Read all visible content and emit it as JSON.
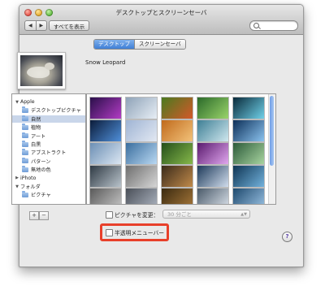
{
  "window": {
    "title": "デスクトップとスクリーンセーバ"
  },
  "toolbar": {
    "back": "◀",
    "forward": "▶",
    "show_all": "すべてを表示",
    "search_placeholder": ""
  },
  "tabs": [
    {
      "label": "デスクトップ",
      "active": true
    },
    {
      "label": "スクリーンセーバ",
      "active": false
    }
  ],
  "current_picture": {
    "name": "Snow Leopard"
  },
  "sources": [
    {
      "label": "Apple",
      "level": 0,
      "expander": "▼",
      "folder": false,
      "selected": false
    },
    {
      "label": "デスクトップピクチャ",
      "level": 1,
      "folder": true,
      "selected": false
    },
    {
      "label": "自然",
      "level": 1,
      "folder": true,
      "selected": true
    },
    {
      "label": "植物",
      "level": 1,
      "folder": true,
      "selected": false
    },
    {
      "label": "アート",
      "level": 1,
      "folder": true,
      "selected": false
    },
    {
      "label": "白黒",
      "level": 1,
      "folder": true,
      "selected": false
    },
    {
      "label": "アブストラクト",
      "level": 1,
      "folder": true,
      "selected": false
    },
    {
      "label": "パターン",
      "level": 1,
      "folder": true,
      "selected": false
    },
    {
      "label": "無地の色",
      "level": 1,
      "folder": true,
      "selected": false
    },
    {
      "label": "iPhoto",
      "level": 0,
      "expander": "▶",
      "folder": false,
      "selected": false
    },
    {
      "label": "フォルダ",
      "level": 0,
      "expander": "▼",
      "folder": false,
      "selected": false
    },
    {
      "label": "ピクチャ",
      "level": 1,
      "folder": true,
      "selected": false
    }
  ],
  "thumbnails": [
    [
      "#2a0f4a",
      "#b23cc4"
    ],
    [
      "#8fa3b8",
      "#e7eef5"
    ],
    [
      "#4a7a1f",
      "#d4582a"
    ],
    [
      "#2b6a2a",
      "#9ad46a"
    ],
    [
      "#0a2a3a",
      "#6fd0e8"
    ],
    [
      "#0b1c3a",
      "#4f8fd9"
    ],
    [
      "#9fb4d4",
      "#e2e8f2"
    ],
    [
      "#c06a1c",
      "#f2c27a"
    ],
    [
      "#3e7f95",
      "#cfe7ee"
    ],
    [
      "#0d2f58",
      "#8bc3ef"
    ],
    [
      "#6c8fb4",
      "#dbe6f2"
    ],
    [
      "#3a6e9e",
      "#b9d8f2"
    ],
    [
      "#244e1a",
      "#86b84a"
    ],
    [
      "#5a1a6e",
      "#e0a6ee"
    ],
    [
      "#2c5b3a",
      "#a8d4a0"
    ],
    [
      "#2f3a44",
      "#b8c2ca"
    ],
    [
      "#6e6e6e",
      "#d6d6d6"
    ],
    [
      "#3a2a1a",
      "#c08a4a"
    ],
    [
      "#1d3a5a",
      "#d0dcec"
    ],
    [
      "#0f3554",
      "#72b2dc"
    ],
    [
      "#5a5a5a",
      "#c8c8c8"
    ],
    [
      "#4a4f58",
      "#aeb6c2"
    ],
    [
      "#3a2a10",
      "#a8783a"
    ],
    [
      "#4a5a6a",
      "#dde4ec"
    ],
    [
      "#1f4a6e",
      "#9cc4e6"
    ]
  ],
  "add_label": "+",
  "remove_label": "−",
  "change_picture": {
    "label": "ピクチャを変更：",
    "checked": false,
    "interval": "30 分ごと"
  },
  "translucent_menu": {
    "label": "半透明メニューバー",
    "checked": false
  },
  "help_label": "?",
  "colors": {
    "selection": "#c9d6ea",
    "tab_active": "#3f7fd6",
    "highlight_box": "#e8402a",
    "scroll_thumb": "#6f9ee6"
  }
}
